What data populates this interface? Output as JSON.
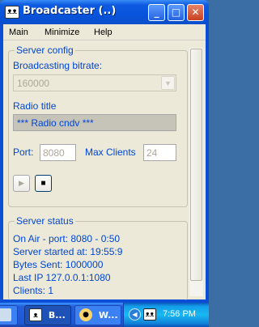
{
  "window": {
    "title": "Broadcaster (..)",
    "controls": {
      "minimize": "_",
      "maximize": "□",
      "close": "✕"
    }
  },
  "menu": [
    "Main",
    "Minimize",
    "Help"
  ],
  "server_config": {
    "group_title": "Server config",
    "bitrate_label": "Broadcasting bitrate:",
    "bitrate_value": "160000",
    "radio_title_label": "Radio title",
    "radio_title_value": "*** Radio cndv ***",
    "port_label": "Port:",
    "port_value": "8080",
    "max_clients_label": "Max Clients",
    "max_clients_value": "24"
  },
  "server_status": {
    "group_title": "Server status",
    "lines": [
      "On Air - port: 8080 - 0:50",
      "Server started at: 19:55:9",
      "Bytes Sent: 1000000",
      "Last IP 127.0.0.1:1080",
      "Clients: 1"
    ]
  },
  "taskbar": {
    "tasks": [
      {
        "label": ""
      },
      {
        "label": "B..."
      },
      {
        "label": "W..."
      }
    ],
    "clock": "7:56 PM"
  },
  "icons": {
    "app": "broadcaster-app-icon",
    "combo_arrow": "chevron-down-icon",
    "play": "play-icon",
    "stop": "stop-icon",
    "tray_expand": "chevron-left-icon"
  }
}
